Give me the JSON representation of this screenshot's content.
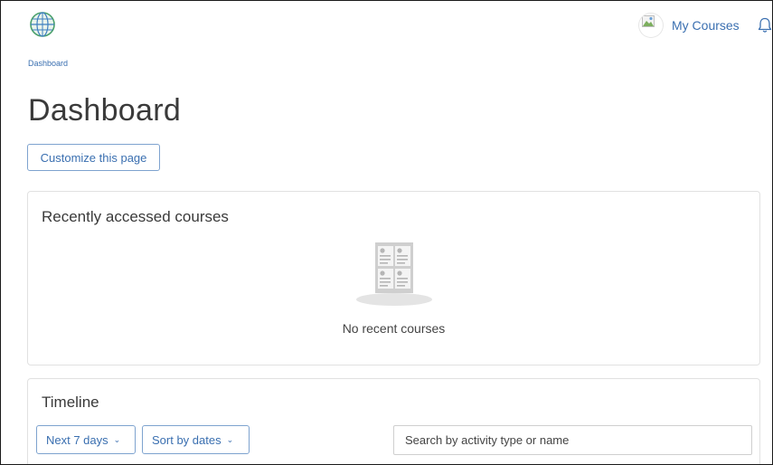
{
  "header": {
    "logo_icon": "globe-logo-icon",
    "user_avatar_icon": "broken-image-icon",
    "user_menu_label": "My Courses",
    "notifications_icon": "bell-icon"
  },
  "breadcrumb": {
    "items": [
      "Dashboard"
    ]
  },
  "page": {
    "title": "Dashboard",
    "customize_label": "Customize this page"
  },
  "recent_courses": {
    "title": "Recently accessed courses",
    "empty_icon": "courses-placeholder-icon",
    "empty_text": "No recent courses"
  },
  "timeline": {
    "title": "Timeline",
    "days_filter_label": "Next 7 days",
    "sort_label": "Sort by dates",
    "search_placeholder": "Search by activity type or name",
    "chevron_icon": "chevron-down-icon"
  },
  "colors": {
    "link": "#3a6fb0",
    "button_border": "#7ea3cf",
    "card_border": "#e1e1e1",
    "title_text": "#3a3a3a"
  }
}
